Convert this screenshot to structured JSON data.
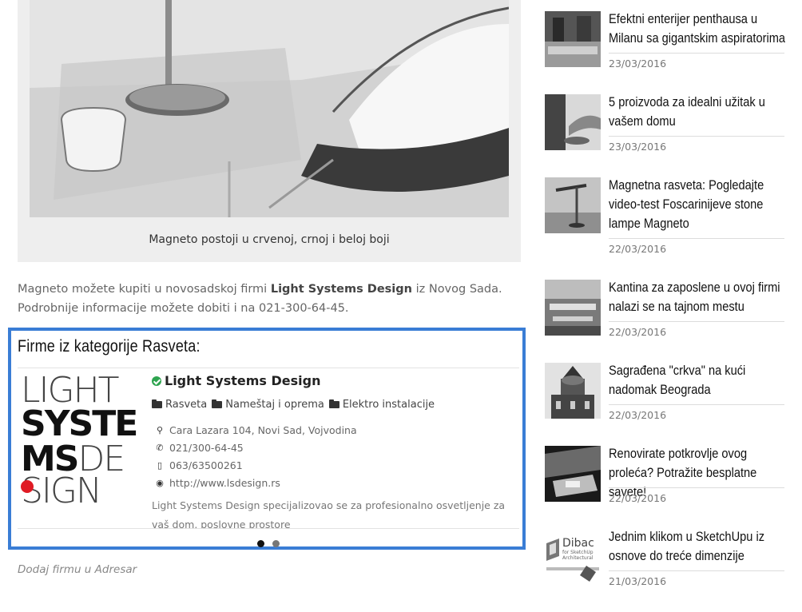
{
  "article": {
    "caption": "Magneto postoji u crvenoj, crnoj i beloj boji",
    "intro_before": "Magneto možete kupiti u novosadskoj firmi ",
    "intro_company": "Light Systems Design",
    "intro_after": " iz Novog Sada. Podrobnije informacije možete dobiti i na 021-300-64-45."
  },
  "firm_section": {
    "title": "Firme iz kategorije Rasveta:",
    "logo_text": [
      "LIGHT",
      "SYSTE",
      "MS",
      "DE",
      "SIGN"
    ],
    "firm": {
      "name": "Light Systems Design",
      "categories": [
        "Rasveta",
        "Nameštaj i oprema",
        "Elektro instalacije"
      ],
      "address": "Cara Lazara 104, Novi Sad, Vojvodina",
      "phone": "021/300-64-45",
      "mobile": "063/63500261",
      "website": "http://www.lsdesign.rs",
      "description": "Light Systems Design specijalizovao se za profesionalno osvetljenje za vaš dom, poslovne prostore"
    },
    "add_link": "Dodaj firmu u Adresar"
  },
  "sidebar": {
    "items": [
      {
        "title": "Efektni enterijer penthausa u Milanu sa gigantskim aspiratorima",
        "date": "23/03/2016"
      },
      {
        "title": "5 proizvoda za idealni užitak u vašem domu",
        "date": "23/03/2016"
      },
      {
        "title": "Magnetna rasveta: Pogledajte video-test Foscarinijeve stone lampe Magneto",
        "date": "22/03/2016"
      },
      {
        "title": "Kantina za zaposlene u ovoj firmi nalazi se na tajnom mestu",
        "date": "22/03/2016"
      },
      {
        "title": "Sagrađena \"crkva\" na kući nadomak Beograda",
        "date": "22/03/2016"
      },
      {
        "title": "Renovirate potkrovlje ovog proleća? Potražite besplatne savete!",
        "date": "22/03/2016"
      },
      {
        "title": "Jednim klikom u SketchUpu iz osnove do treće dimenzije",
        "date": "21/03/2016"
      }
    ],
    "thumb7_text": [
      "Dibac",
      "for SketchUp",
      "Architectural"
    ]
  },
  "colors": {
    "accent_border": "#3a7dd5",
    "logo_dot": "#e01b24",
    "verified": "#2ea44f"
  }
}
